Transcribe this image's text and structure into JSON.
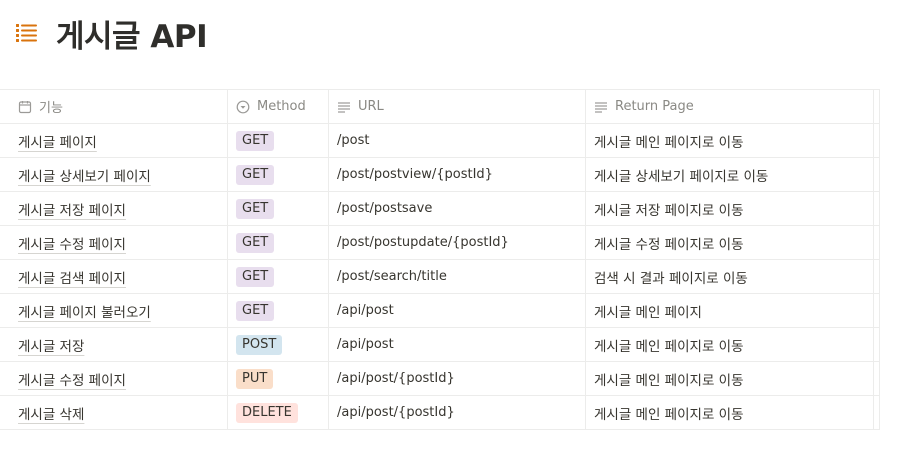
{
  "page": {
    "title": "게시글 API",
    "icon": "bullet-list-icon",
    "icon_color": "#d9730d"
  },
  "table": {
    "columns": [
      {
        "label": "기능",
        "icon": "calendar-icon"
      },
      {
        "label": "Method",
        "icon": "select-icon"
      },
      {
        "label": "URL",
        "icon": "text-lines-icon"
      },
      {
        "label": "Return Page",
        "icon": "text-lines-icon"
      }
    ],
    "method_colors": {
      "GET": "#e8deee",
      "POST": "#d3e5ef",
      "PUT": "#fadec9",
      "DELETE": "#ffe2dd"
    },
    "rows": [
      {
        "name": "게시글 페이지",
        "method": "GET",
        "url": "/post",
        "return_page": "게시글 메인 페이지로 이동"
      },
      {
        "name": "게시글 상세보기 페이지",
        "method": "GET",
        "url": "/post/postview/{postId}",
        "return_page": "게시글 상세보기 페이지로 이동"
      },
      {
        "name": "게시글 저장 페이지",
        "method": "GET",
        "url": "/post/postsave",
        "return_page": "게시글 저장 페이지로 이동"
      },
      {
        "name": "게시글 수정 페이지",
        "method": "GET",
        "url": "/post/postupdate/{postId}",
        "return_page": "게시글 수정 페이지로 이동"
      },
      {
        "name": "게시글 검색 페이지",
        "method": "GET",
        "url": "/post/search/title",
        "return_page": "검색 시 결과 페이지로 이동"
      },
      {
        "name": "게시글 페이지 불러오기",
        "method": "GET",
        "url": "/api/post",
        "return_page": "게시글 메인 페이지"
      },
      {
        "name": "게시글 저장",
        "method": "POST",
        "url": "/api/post",
        "return_page": "게시글 메인 페이지로 이동"
      },
      {
        "name": "게시글 수정 페이지",
        "method": "PUT",
        "url": "/api/post/{postId}",
        "return_page": "게시글 메인 페이지로 이동"
      },
      {
        "name": "게시글 삭제",
        "method": "DELETE",
        "url": "/api/post/{postId}",
        "return_page": "게시글 메인 페이지로 이동"
      }
    ]
  }
}
